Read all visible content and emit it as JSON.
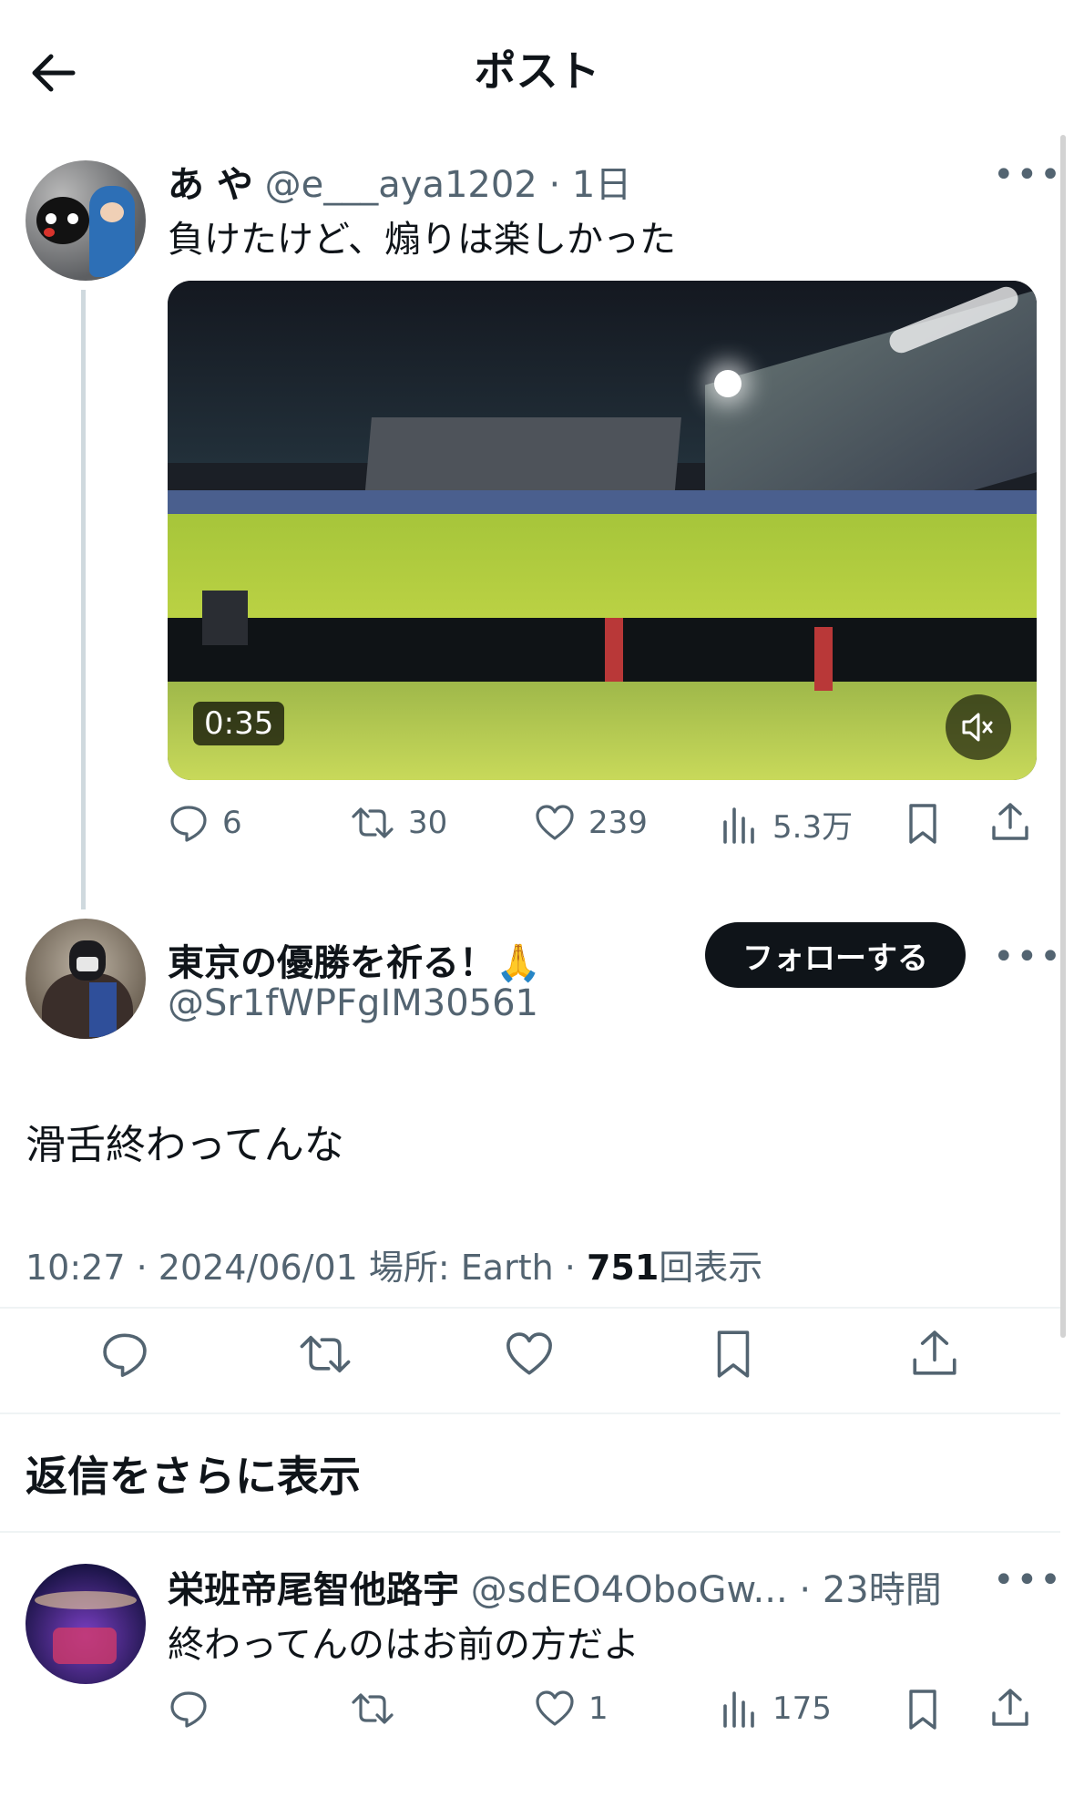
{
  "header": {
    "title": "ポスト"
  },
  "parent_post": {
    "name": "あ や",
    "handle": "@e___aya1202",
    "time": "1日",
    "text": "負けたけど、煽りは楽しかった",
    "video_duration": "0:35",
    "stats": {
      "replies": "6",
      "reposts": "30",
      "likes": "239",
      "views": "5.3万"
    }
  },
  "main_post": {
    "name": "東京の優勝を祈る！🙏",
    "handle": "@Sr1fWPFgIM30561",
    "follow_label": "フォローする",
    "text": "滑舌終わってんな",
    "time": "10:27",
    "date": "2024/06/01",
    "location": "場所: Earth",
    "views_count": "751",
    "views_label": "回表示"
  },
  "more_replies": {
    "title": "返信をさらに表示"
  },
  "reply": {
    "name": "栄班帝尾智他路宇",
    "handle": "@sdEO4OboGw...",
    "time": "23時間",
    "text": "終わってんのはお前の方だよ",
    "stats": {
      "likes": "1",
      "views": "175"
    }
  },
  "colors": {
    "text": "#0f1419",
    "muted": "#536471",
    "follow_bg": "#0f1419",
    "divider": "#eff3f4"
  }
}
